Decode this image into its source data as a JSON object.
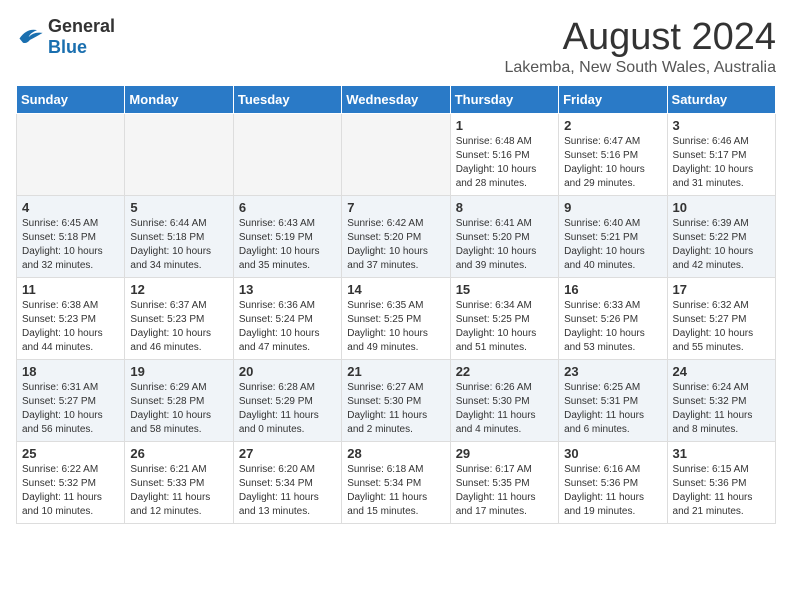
{
  "logo": {
    "text_general": "General",
    "text_blue": "Blue"
  },
  "title": "August 2024",
  "subtitle": "Lakemba, New South Wales, Australia",
  "days_of_week": [
    "Sunday",
    "Monday",
    "Tuesday",
    "Wednesday",
    "Thursday",
    "Friday",
    "Saturday"
  ],
  "weeks": [
    [
      {
        "day": "",
        "empty": true
      },
      {
        "day": "",
        "empty": true
      },
      {
        "day": "",
        "empty": true
      },
      {
        "day": "",
        "empty": true
      },
      {
        "day": "1",
        "sunrise": "6:48 AM",
        "sunset": "5:16 PM",
        "daylight": "10 hours and 28 minutes."
      },
      {
        "day": "2",
        "sunrise": "6:47 AM",
        "sunset": "5:16 PM",
        "daylight": "10 hours and 29 minutes."
      },
      {
        "day": "3",
        "sunrise": "6:46 AM",
        "sunset": "5:17 PM",
        "daylight": "10 hours and 31 minutes."
      }
    ],
    [
      {
        "day": "4",
        "sunrise": "6:45 AM",
        "sunset": "5:18 PM",
        "daylight": "10 hours and 32 minutes."
      },
      {
        "day": "5",
        "sunrise": "6:44 AM",
        "sunset": "5:18 PM",
        "daylight": "10 hours and 34 minutes."
      },
      {
        "day": "6",
        "sunrise": "6:43 AM",
        "sunset": "5:19 PM",
        "daylight": "10 hours and 35 minutes."
      },
      {
        "day": "7",
        "sunrise": "6:42 AM",
        "sunset": "5:20 PM",
        "daylight": "10 hours and 37 minutes."
      },
      {
        "day": "8",
        "sunrise": "6:41 AM",
        "sunset": "5:20 PM",
        "daylight": "10 hours and 39 minutes."
      },
      {
        "day": "9",
        "sunrise": "6:40 AM",
        "sunset": "5:21 PM",
        "daylight": "10 hours and 40 minutes."
      },
      {
        "day": "10",
        "sunrise": "6:39 AM",
        "sunset": "5:22 PM",
        "daylight": "10 hours and 42 minutes."
      }
    ],
    [
      {
        "day": "11",
        "sunrise": "6:38 AM",
        "sunset": "5:23 PM",
        "daylight": "10 hours and 44 minutes."
      },
      {
        "day": "12",
        "sunrise": "6:37 AM",
        "sunset": "5:23 PM",
        "daylight": "10 hours and 46 minutes."
      },
      {
        "day": "13",
        "sunrise": "6:36 AM",
        "sunset": "5:24 PM",
        "daylight": "10 hours and 47 minutes."
      },
      {
        "day": "14",
        "sunrise": "6:35 AM",
        "sunset": "5:25 PM",
        "daylight": "10 hours and 49 minutes."
      },
      {
        "day": "15",
        "sunrise": "6:34 AM",
        "sunset": "5:25 PM",
        "daylight": "10 hours and 51 minutes."
      },
      {
        "day": "16",
        "sunrise": "6:33 AM",
        "sunset": "5:26 PM",
        "daylight": "10 hours and 53 minutes."
      },
      {
        "day": "17",
        "sunrise": "6:32 AM",
        "sunset": "5:27 PM",
        "daylight": "10 hours and 55 minutes."
      }
    ],
    [
      {
        "day": "18",
        "sunrise": "6:31 AM",
        "sunset": "5:27 PM",
        "daylight": "10 hours and 56 minutes."
      },
      {
        "day": "19",
        "sunrise": "6:29 AM",
        "sunset": "5:28 PM",
        "daylight": "10 hours and 58 minutes."
      },
      {
        "day": "20",
        "sunrise": "6:28 AM",
        "sunset": "5:29 PM",
        "daylight": "11 hours and 0 minutes."
      },
      {
        "day": "21",
        "sunrise": "6:27 AM",
        "sunset": "5:30 PM",
        "daylight": "11 hours and 2 minutes."
      },
      {
        "day": "22",
        "sunrise": "6:26 AM",
        "sunset": "5:30 PM",
        "daylight": "11 hours and 4 minutes."
      },
      {
        "day": "23",
        "sunrise": "6:25 AM",
        "sunset": "5:31 PM",
        "daylight": "11 hours and 6 minutes."
      },
      {
        "day": "24",
        "sunrise": "6:24 AM",
        "sunset": "5:32 PM",
        "daylight": "11 hours and 8 minutes."
      }
    ],
    [
      {
        "day": "25",
        "sunrise": "6:22 AM",
        "sunset": "5:32 PM",
        "daylight": "11 hours and 10 minutes."
      },
      {
        "day": "26",
        "sunrise": "6:21 AM",
        "sunset": "5:33 PM",
        "daylight": "11 hours and 12 minutes."
      },
      {
        "day": "27",
        "sunrise": "6:20 AM",
        "sunset": "5:34 PM",
        "daylight": "11 hours and 13 minutes."
      },
      {
        "day": "28",
        "sunrise": "6:18 AM",
        "sunset": "5:34 PM",
        "daylight": "11 hours and 15 minutes."
      },
      {
        "day": "29",
        "sunrise": "6:17 AM",
        "sunset": "5:35 PM",
        "daylight": "11 hours and 17 minutes."
      },
      {
        "day": "30",
        "sunrise": "6:16 AM",
        "sunset": "5:36 PM",
        "daylight": "11 hours and 19 minutes."
      },
      {
        "day": "31",
        "sunrise": "6:15 AM",
        "sunset": "5:36 PM",
        "daylight": "11 hours and 21 minutes."
      }
    ]
  ],
  "labels": {
    "sunrise_prefix": "Sunrise: ",
    "sunset_prefix": "Sunset: ",
    "daylight_prefix": "Daylight: "
  }
}
